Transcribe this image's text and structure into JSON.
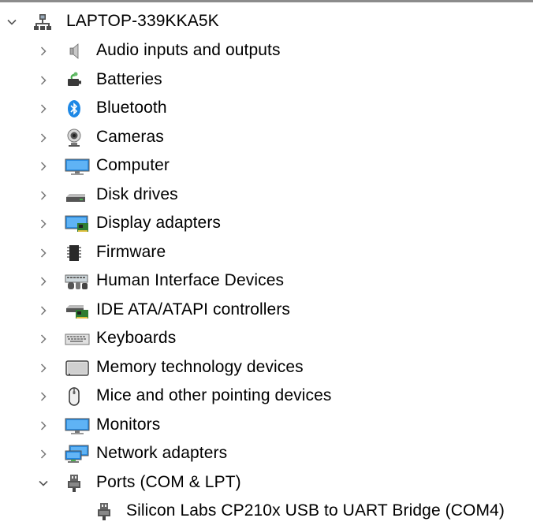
{
  "root": {
    "label": "LAPTOP-339KKA5K",
    "expanded": true,
    "icon": "computer-network-icon"
  },
  "categories": [
    {
      "label": "Audio inputs and outputs",
      "icon": "speaker-icon",
      "expanded": false
    },
    {
      "label": "Batteries",
      "icon": "battery-icon",
      "expanded": false
    },
    {
      "label": "Bluetooth",
      "icon": "bluetooth-icon",
      "expanded": false
    },
    {
      "label": "Cameras",
      "icon": "webcam-icon",
      "expanded": false
    },
    {
      "label": "Computer",
      "icon": "monitor-icon",
      "expanded": false
    },
    {
      "label": "Disk drives",
      "icon": "disk-drive-icon",
      "expanded": false
    },
    {
      "label": "Display adapters",
      "icon": "display-adapter-icon",
      "expanded": false
    },
    {
      "label": "Firmware",
      "icon": "chip-icon",
      "expanded": false
    },
    {
      "label": "Human Interface Devices",
      "icon": "hid-icon",
      "expanded": false
    },
    {
      "label": "IDE ATA/ATAPI controllers",
      "icon": "ide-controller-icon",
      "expanded": false
    },
    {
      "label": "Keyboards",
      "icon": "keyboard-icon",
      "expanded": false
    },
    {
      "label": "Memory technology devices",
      "icon": "memory-card-icon",
      "expanded": false
    },
    {
      "label": "Mice and other pointing devices",
      "icon": "mouse-icon",
      "expanded": false
    },
    {
      "label": "Monitors",
      "icon": "monitor-icon",
      "expanded": false
    },
    {
      "label": "Network adapters",
      "icon": "network-adapter-icon",
      "expanded": false
    },
    {
      "label": "Ports (COM & LPT)",
      "icon": "port-plug-icon",
      "expanded": true,
      "children": [
        {
          "label": "Silicon Labs CP210x USB to UART Bridge (COM4)",
          "icon": "port-plug-icon"
        }
      ]
    }
  ],
  "colors": {
    "chevron": "#666666",
    "top_border": "#8c8c8c",
    "accent_blue": "#0078d7"
  }
}
